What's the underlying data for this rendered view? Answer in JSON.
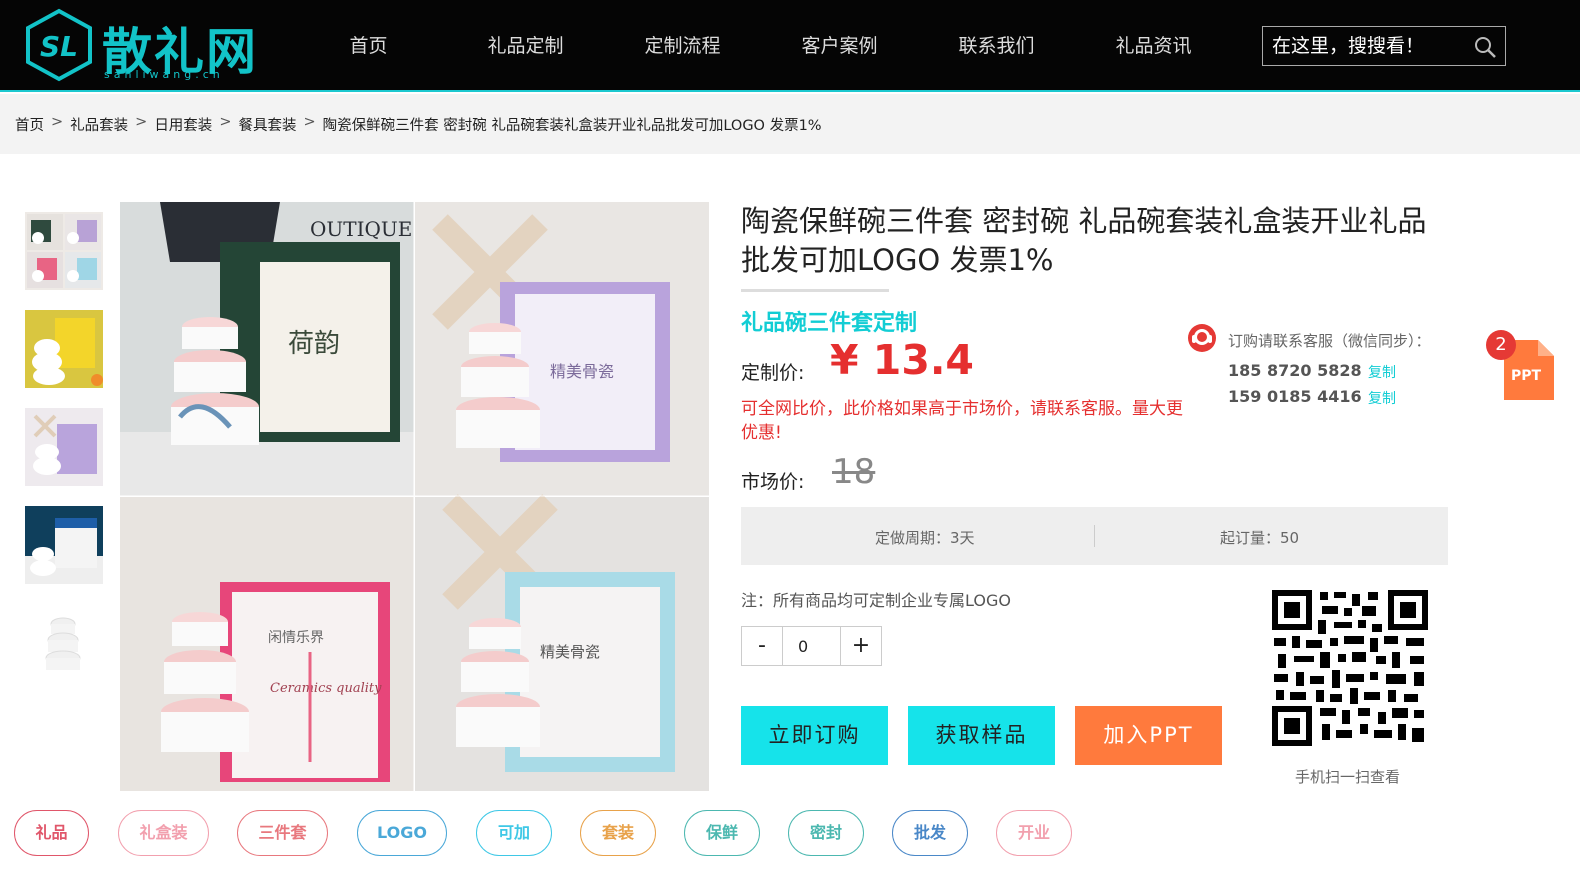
{
  "header": {
    "logo_text": "散礼网",
    "logo_sub": "sanliwang.cn",
    "logo_mark": "SL",
    "nav": [
      "首页",
      "礼品定制",
      "定制流程",
      "客户案例",
      "联系我们",
      "礼品资讯"
    ],
    "search_placeholder": "在这里，搜搜看！"
  },
  "breadcrumb": [
    "首页",
    "礼品套装",
    "日用套装",
    "餐具套装",
    "陶瓷保鲜碗三件套 密封碗 礼品碗套装礼盒装开业礼品批发可加LOGO 发票1%"
  ],
  "breadcrumb_sep": ">",
  "product": {
    "title": "陶瓷保鲜碗三件套 密封碗 礼品碗套装礼盒装开业礼品批发可加LOGO 发票1%",
    "subtitle": "礼品碗三件套定制",
    "price_label": "定制价:",
    "price": "¥ 13.4",
    "price_note": "可全网比价，此价格如果高于市场价，请联系客服。量大更优惠!",
    "market_label": "市场价:",
    "market_price": "18",
    "period_label": "定做周期：",
    "period_value": "3天",
    "moq_label": "起订量：",
    "moq_value": "50",
    "note": "注：所有商品均可定制企业专属LOGO",
    "quantity": "0",
    "qty_minus": "-",
    "qty_plus": "+",
    "btn_buy": "立即订购",
    "btn_sample": "获取样品",
    "btn_ppt": "加入PPT"
  },
  "contact": {
    "title": "订购请联系客服（微信同步）：",
    "phones": [
      "185 8720 5828",
      "159 0185 4416"
    ],
    "copy_label": "复制"
  },
  "ppt_float": {
    "badge": "2",
    "label": "PPT"
  },
  "qr_caption": "手机扫一扫查看",
  "main_image_box_texts": [
    "OUTIQUE",
    "荷韵",
    "精美骨瓷",
    "闲情乐界",
    "Ceramics quality",
    "精美骨瓷"
  ],
  "tags": [
    {
      "label": "礼品",
      "color": "#e0566a"
    },
    {
      "label": "礼盒装",
      "color": "#f2a0ae"
    },
    {
      "label": "三件套",
      "color": "#e8787e"
    },
    {
      "label": "LOGO",
      "color": "#4aa8d8"
    },
    {
      "label": "可加",
      "color": "#3fc8e6"
    },
    {
      "label": "套装",
      "color": "#e8a24a"
    },
    {
      "label": "保鲜",
      "color": "#4cb8b0"
    },
    {
      "label": "密封",
      "color": "#4cb8b0"
    },
    {
      "label": "批发",
      "color": "#4a88c8"
    },
    {
      "label": "开业",
      "color": "#f2a0ae"
    }
  ],
  "colors": {
    "accent": "#12cdd4",
    "price_red": "#e52f2f",
    "ppt_orange": "#ff7a3d",
    "header_bg": "#050505"
  }
}
